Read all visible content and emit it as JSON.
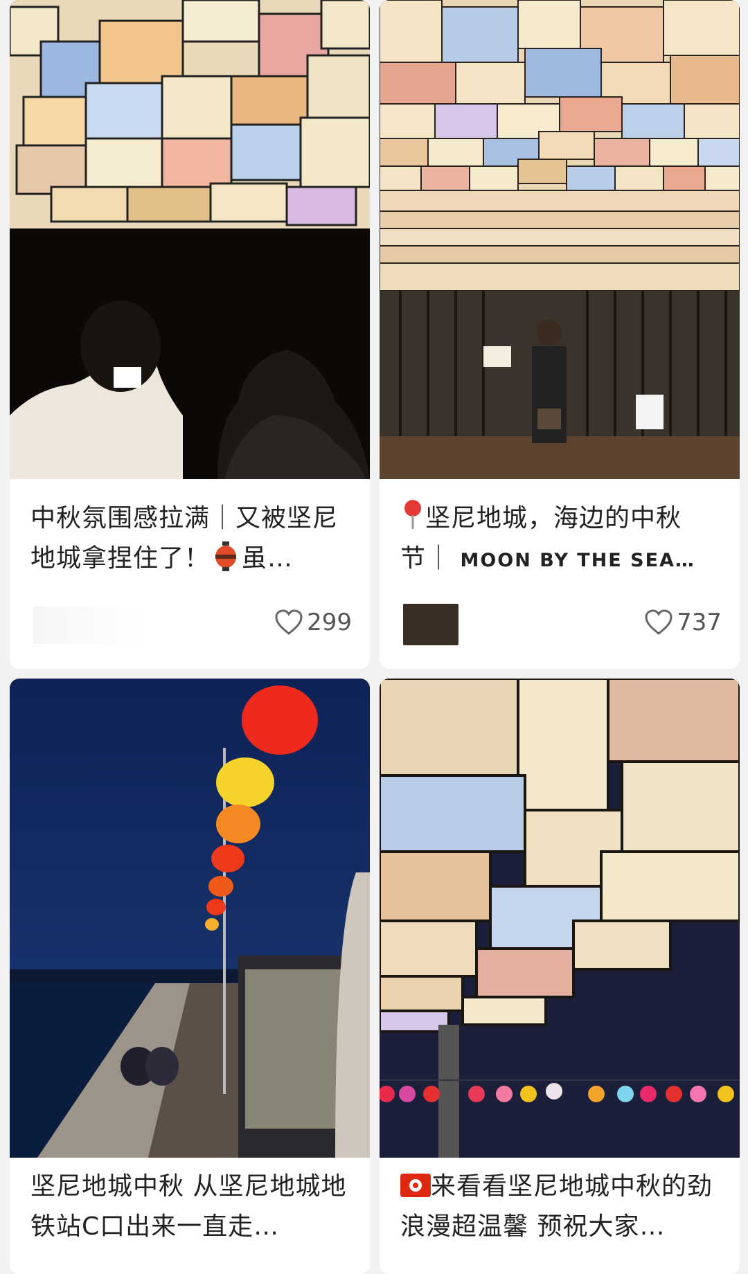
{
  "cards": [
    {
      "title": "中秋氛围感拉满｜又被坚尼地城拿捏住了！",
      "title_tail": "虽…",
      "likes": "299",
      "icon": "lantern-emoji-icon"
    },
    {
      "title_prefix": "坚尼地城，海边的中秋",
      "title_line2_cn": "节｜",
      "title_line2_en": "MOON BY THE SEA…",
      "likes": "737",
      "icon": "map-pin-icon"
    },
    {
      "title": "坚尼地城中秋 从坚尼地城地铁站C口出来一直走…"
    },
    {
      "title": "来看看坚尼地城中秋的劲浪漫超温馨 预祝大家…",
      "icon": "hong-kong-flag-icon"
    }
  ],
  "colors": {
    "background": "#f2f2f2",
    "card": "#ffffff",
    "text": "#222222",
    "likes": "#555555"
  }
}
